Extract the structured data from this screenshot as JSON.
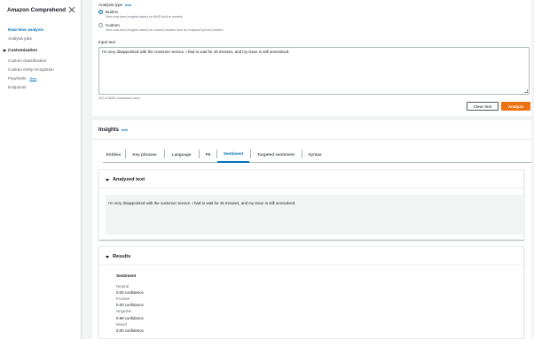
{
  "sidebar": {
    "title": "Amazon Comprehend",
    "nav": [
      "Real-time analysis",
      "Analysis jobs"
    ],
    "section": "Customization",
    "sub": [
      "Custom classification",
      "Custom entity recognition",
      "Flywheels",
      "Endpoints"
    ],
    "new_badge": "New"
  },
  "analysis": {
    "type_label": "Analysis type",
    "info": "Info",
    "builtin_title": "Built-in",
    "builtin_desc": "View real-time insights based on AWS built-in models.",
    "custom_title": "Custom",
    "custom_desc": "View real-time insights based on custom models from an endpoint you've created."
  },
  "input": {
    "label": "Input text",
    "value": "I'm very disappointed with the customer service. I had to wait for 45 minutes, and my issue is still unresolved.",
    "char_count": "112 of 5000 characters used."
  },
  "buttons": {
    "clear": "Clear text",
    "analyze": "Analyze"
  },
  "insights": {
    "title": "Insights",
    "info": "Info",
    "tabs": [
      "Entities",
      "Key phrases",
      "Language",
      "PII",
      "Sentiment",
      "Targeted sentiment",
      "Syntax"
    ],
    "active_tab": "Sentiment"
  },
  "analyzed": {
    "title": "Analyzed text",
    "text": "I'm very disappointed with the customer service. I had to wait for 45 minutes, and my issue is still unresolved."
  },
  "results": {
    "title": "Results",
    "heading": "Sentiment",
    "items": [
      {
        "label": "Neutral",
        "value": "0.00 confidence"
      },
      {
        "label": "Positive",
        "value": "0.00 confidence"
      },
      {
        "label": "Negative",
        "value": "0.99 confidence"
      },
      {
        "label": "Mixed",
        "value": "0.00 confidence"
      }
    ]
  },
  "colors": {
    "accent": "#0073bb",
    "analyze_button": "#ec7211",
    "background": "#f2f3f3"
  }
}
